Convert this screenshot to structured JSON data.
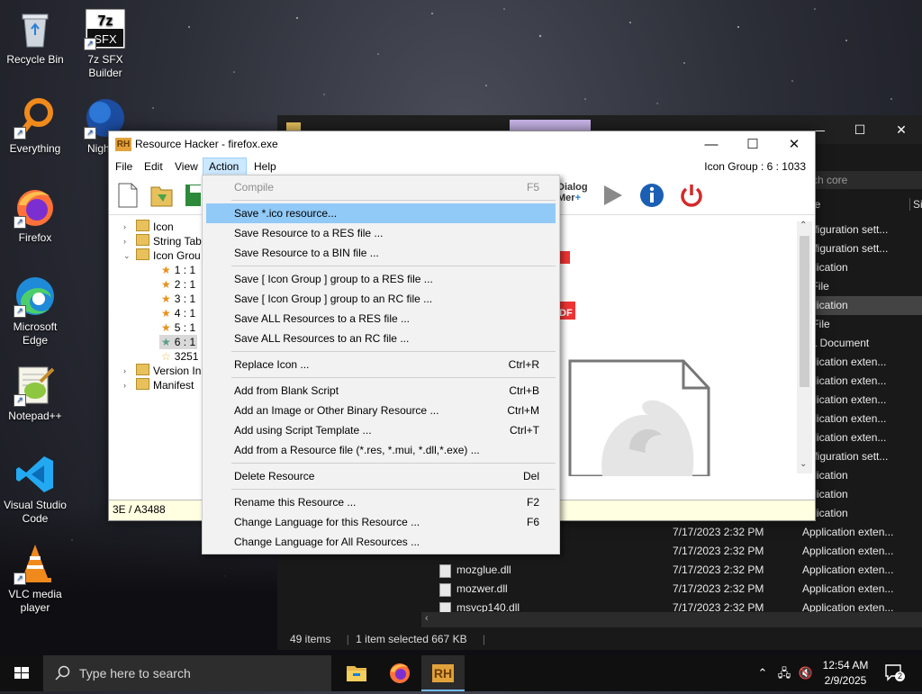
{
  "desktop": {
    "icons": [
      {
        "label": "Recycle Bin"
      },
      {
        "label": "7z SFX Builder"
      },
      {
        "label": "Everything"
      },
      {
        "label": "Nigh"
      },
      {
        "label": "Firefox"
      },
      {
        "label": "Microsoft Edge"
      },
      {
        "label": "Notepad++"
      },
      {
        "label": "Visual Studio Code"
      },
      {
        "label": "VLC media player"
      }
    ]
  },
  "explorer": {
    "search_placeholder": "rch core",
    "column_type": "pe",
    "column_size": "Siz",
    "rows": [
      {
        "name": "",
        "date": "",
        "type": "onfiguration sett..."
      },
      {
        "name": "",
        "date": "",
        "type": "onfiguration sett..."
      },
      {
        "name": "",
        "date": "",
        "type": "pplication"
      },
      {
        "name": "",
        "date": "",
        "type": "T File"
      },
      {
        "name": "",
        "date": "",
        "type": "pplication"
      },
      {
        "name": "",
        "date": "",
        "type": "S File"
      },
      {
        "name": "",
        "date": "",
        "type": "ML Document"
      },
      {
        "name": "",
        "date": "",
        "type": "pplication exten..."
      },
      {
        "name": "",
        "date": "",
        "type": "pplication exten..."
      },
      {
        "name": "",
        "date": "",
        "type": "pplication exten..."
      },
      {
        "name": "",
        "date": "",
        "type": "pplication exten..."
      },
      {
        "name": "",
        "date": "",
        "type": "pplication exten..."
      },
      {
        "name": "",
        "date": "",
        "type": "onfiguration sett..."
      },
      {
        "name": "",
        "date": "",
        "type": "pplication"
      },
      {
        "name": "",
        "date": "",
        "type": "pplication"
      },
      {
        "name": "",
        "date": "",
        "type": "pplication"
      },
      {
        "name": "",
        "date": "7/17/2023 2:32 PM",
        "type": "Application exten..."
      },
      {
        "name": "",
        "date": "7/17/2023 2:32 PM",
        "type": "Application exten..."
      },
      {
        "name": "mozglue.dll",
        "date": "7/17/2023 2:32 PM",
        "type": "Application exten..."
      },
      {
        "name": "mozwer.dll",
        "date": "7/17/2023 2:32 PM",
        "type": "Application exten..."
      },
      {
        "name": "msvcp140.dll",
        "date": "7/17/2023 2:32 PM",
        "type": "Application exten..."
      }
    ],
    "status": {
      "items": "49 items",
      "selected": "1 item selected  667 KB"
    }
  },
  "rh": {
    "title": "Resource Hacker - firefox.exe",
    "logo": "RH",
    "menus": [
      "File",
      "Edit",
      "View",
      "Action",
      "Help"
    ],
    "info": "Icon Group : 6 : 1033",
    "toolbar_dialog_label": "Dialog Mer",
    "tree": {
      "icon": "Icon",
      "string_table": "String Tab",
      "icon_group": "Icon Grou",
      "items": [
        "1 : 1",
        "2 : 1",
        "3 : 1",
        "4 : 1",
        "5 : 1",
        "6 : 1"
      ],
      "item_325": "3251",
      "version_info": "Version In",
      "manifest": "Manifest"
    },
    "status_text": "3E / A3488"
  },
  "action_menu": {
    "items": [
      {
        "label": "Compile",
        "shortcut": "F5"
      },
      {
        "label": "Save *.ico resource...",
        "shortcut": ""
      },
      {
        "label": "Save Resource to a RES file ...",
        "shortcut": ""
      },
      {
        "label": "Save Resource to a BIN file ...",
        "shortcut": ""
      },
      {
        "label": "Save [ Icon Group ] group to a RES file ...",
        "shortcut": ""
      },
      {
        "label": "Save [ Icon Group ] group to an RC file ...",
        "shortcut": ""
      },
      {
        "label": "Save ALL Resources to a RES file ...",
        "shortcut": ""
      },
      {
        "label": "Save ALL Resources to an RC file ...",
        "shortcut": ""
      },
      {
        "label": "Replace Icon ...",
        "shortcut": "Ctrl+R"
      },
      {
        "label": "Add from Blank Script",
        "shortcut": "Ctrl+B"
      },
      {
        "label": "Add an Image or Other Binary Resource ...",
        "shortcut": "Ctrl+M"
      },
      {
        "label": "Add using Script Template ...",
        "shortcut": "Ctrl+T"
      },
      {
        "label": "Add from a Resource file (*.res, *.mui, *.dll,*.exe) ...",
        "shortcut": ""
      },
      {
        "label": "Delete Resource",
        "shortcut": "Del"
      },
      {
        "label": "Rename this Resource ...",
        "shortcut": "F2"
      },
      {
        "label": "Change Language for this Resource ...",
        "shortcut": "F6"
      },
      {
        "label": "Change Language for All Resources ...",
        "shortcut": ""
      }
    ]
  },
  "taskbar": {
    "search_placeholder": "Type here to search",
    "time": "12:54 AM",
    "date": "2/9/2025",
    "notification_count": "2",
    "rh_label": "RH"
  },
  "colors": {
    "menu_highlight": "#91c9f7",
    "status_bar": "#ffffe1",
    "taskbar": "#101010",
    "power_red": "#d42a2a",
    "info_blue": "#1a5fb4"
  }
}
